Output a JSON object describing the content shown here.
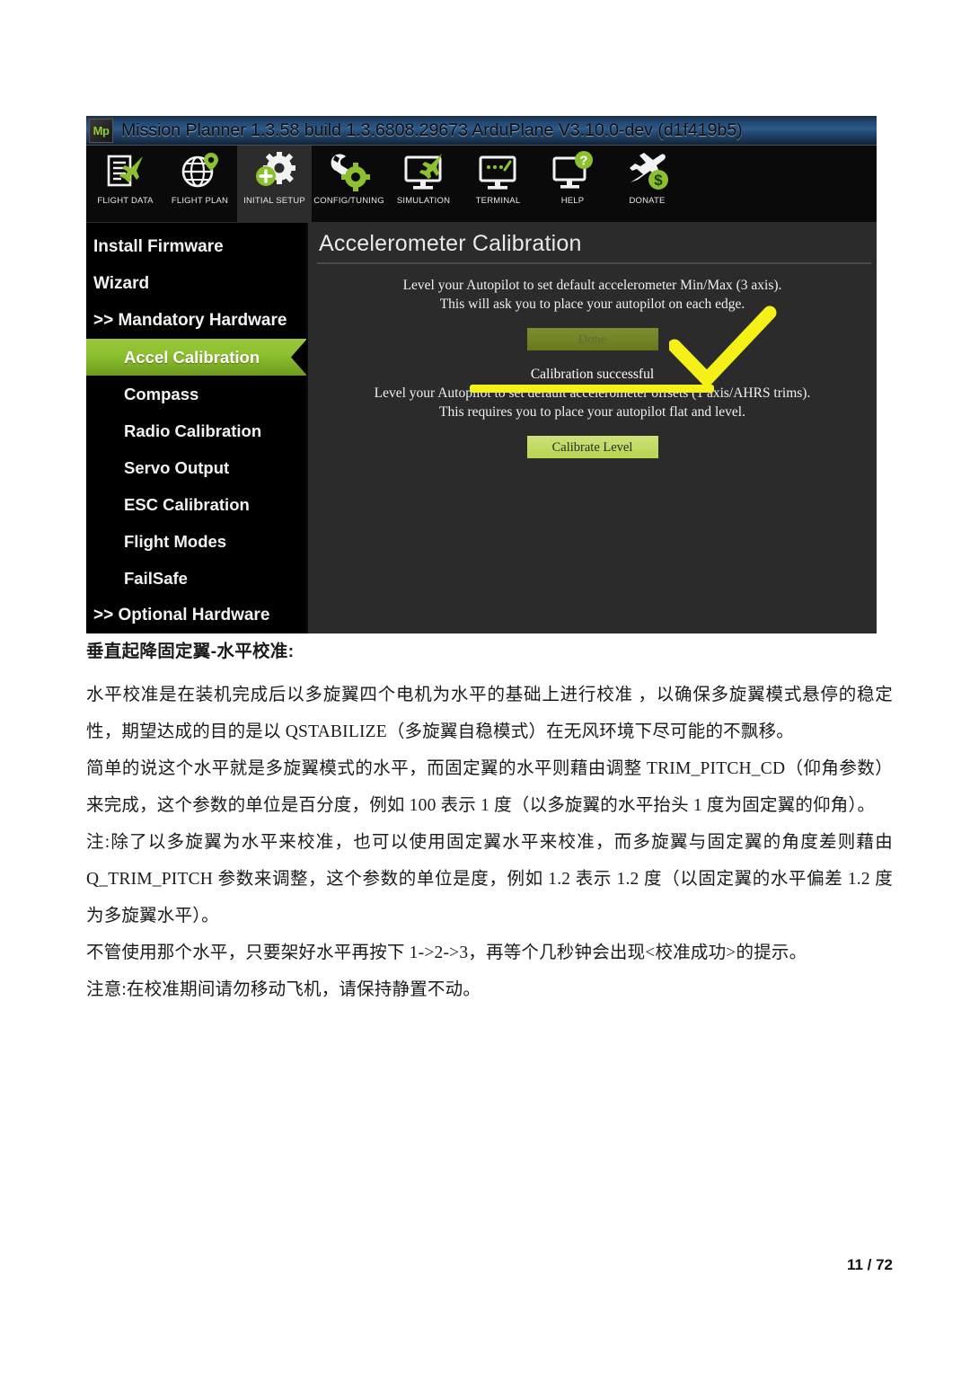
{
  "app_window": {
    "logo_text": "Mp",
    "title": "Mission Planner 1.3.58 build 1.3.6808.29673 ArduPlane V3.10.0-dev (d1f419b5)",
    "toolbar": [
      {
        "label": "FLIGHT DATA",
        "icon": "flight-data-icon",
        "active": false
      },
      {
        "label": "FLIGHT PLAN",
        "icon": "flight-plan-icon",
        "active": false
      },
      {
        "label": "INITIAL SETUP",
        "icon": "initial-setup-icon",
        "active": true
      },
      {
        "label": "CONFIG/TUNING",
        "icon": "config-tuning-icon",
        "active": false
      },
      {
        "label": "SIMULATION",
        "icon": "simulation-icon",
        "active": false
      },
      {
        "label": "TERMINAL",
        "icon": "terminal-icon",
        "active": false
      },
      {
        "label": "HELP",
        "icon": "help-icon",
        "active": false
      },
      {
        "label": "DONATE",
        "icon": "donate-icon",
        "active": false
      }
    ],
    "sidebar": [
      {
        "label": "Install Firmware",
        "level": 0,
        "selected": false
      },
      {
        "label": "Wizard",
        "level": 0,
        "selected": false
      },
      {
        "label": ">> Mandatory Hardware",
        "level": 0,
        "selected": false
      },
      {
        "label": "Accel Calibration",
        "level": 1,
        "selected": true
      },
      {
        "label": "Compass",
        "level": 1,
        "selected": false
      },
      {
        "label": "Radio Calibration",
        "level": 1,
        "selected": false
      },
      {
        "label": "Servo Output",
        "level": 1,
        "selected": false
      },
      {
        "label": "ESC Calibration",
        "level": 1,
        "selected": false
      },
      {
        "label": "Flight Modes",
        "level": 1,
        "selected": false
      },
      {
        "label": "FailSafe",
        "level": 1,
        "selected": false
      },
      {
        "label": ">> Optional Hardware",
        "level": 0,
        "selected": false
      }
    ],
    "panel": {
      "title": "Accelerometer Calibration",
      "instruction_1_line1": "Level your Autopilot to set default accelerometer Min/Max (3 axis).",
      "instruction_1_line2": "This will ask you to place your autopilot on each edge.",
      "done_button": "Done",
      "status": "Calibration successful",
      "instruction_2_line1": "Level your Autopilot to set default accelerometer offsets (1 axis/AHRS trims).",
      "instruction_2_line2": "This requires you to place your autopilot flat and level.",
      "calibrate_level_button": "Calibrate Level"
    },
    "annotations": {
      "highlight_color": "#f5f018",
      "check_color": "#f5f018",
      "accent_green": "#8cc02e"
    }
  },
  "document": {
    "heading": "垂直起降固定翼-水平校准:",
    "paragraphs": [
      "水平校准是在装机完成后以多旋翼四个电机为水平的基础上进行校准 ，以确保多旋翼模式悬停的稳定性，期望达成的目的是以 QSTABILIZE（多旋翼自稳模式）在无风环境下尽可能的不飘移。",
      "简单的说这个水平就是多旋翼模式的水平，而固定翼的水平则藉由调整 TRIM_PITCH_CD（仰角参数）来完成，这个参数的单位是百分度，例如 100 表示 1 度（以多旋翼的水平抬头 1 度为固定翼的仰角）。",
      "注:除了以多旋翼为水平来校准，也可以使用固定翼水平来校准，而多旋翼与固定翼的角度差则藉由 Q_TRIM_PITCH 参数来调整，这个参数的单位是度，例如 1.2 表示 1.2 度（以固定翼的水平偏差 1.2 度为多旋翼水平）。",
      "不管使用那个水平，只要架好水平再按下 1->2->3，再等个几秒钟会出现<校准成功>的提示。",
      "注意:在校准期间请勿移动飞机，请保持静置不动。"
    ],
    "page_number": "11 / 72"
  }
}
